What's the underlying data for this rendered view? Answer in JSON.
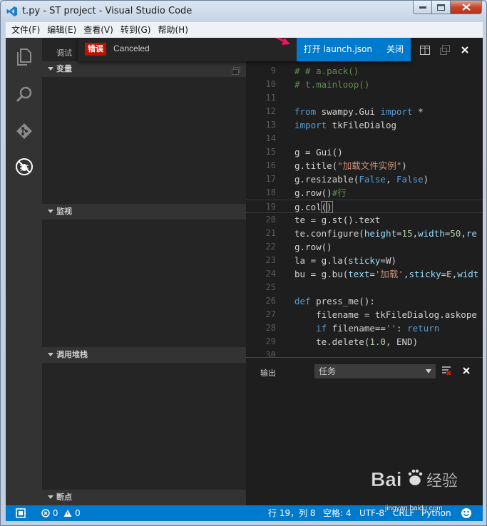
{
  "window": {
    "title": "t.py - ST project - Visual Studio Code"
  },
  "menu": [
    "文件(F)",
    "编辑(E)",
    "查看(V)",
    "转到(G)",
    "帮助(H)"
  ],
  "sidebar": {
    "title": "调试",
    "sections": [
      {
        "label": "变量"
      },
      {
        "label": "监视"
      },
      {
        "label": "调用堆栈"
      },
      {
        "label": "断点"
      }
    ]
  },
  "notification": {
    "badge": "错误",
    "message": "Canceled",
    "action_primary": "打开 launch.json",
    "action_close": "关闭"
  },
  "editor": {
    "lines": [
      {
        "n": "9",
        "text": "# # a.pack()"
      },
      {
        "n": "10",
        "text": "# t.mainloop()"
      },
      {
        "n": "11",
        "text": ""
      },
      {
        "n": "12",
        "text": "from swampy.Gui import *"
      },
      {
        "n": "13",
        "text": "import tkFileDialog"
      },
      {
        "n": "14",
        "text": ""
      },
      {
        "n": "15",
        "text": "g = Gui()"
      },
      {
        "n": "16",
        "text": "g.title(\"加载文件实例\")"
      },
      {
        "n": "17",
        "text": "g.resizable(False, False)"
      },
      {
        "n": "18",
        "text": "g.row()#行"
      },
      {
        "n": "19",
        "text": "g.col()"
      },
      {
        "n": "20",
        "text": "te = g.st().text"
      },
      {
        "n": "21",
        "text": "te.configure(height=15,width=50,re"
      },
      {
        "n": "22",
        "text": "g.row()"
      },
      {
        "n": "23",
        "text": "la = g.la(sticky=W)"
      },
      {
        "n": "24",
        "text": "bu = g.bu(text='加载',sticky=E,widt"
      },
      {
        "n": "25",
        "text": ""
      },
      {
        "n": "26",
        "text": "def press_me():"
      },
      {
        "n": "27",
        "text": "    filename = tkFileDialog.askope"
      },
      {
        "n": "28",
        "text": "    if filename=='': return"
      },
      {
        "n": "29",
        "text": "    te.delete(1.0, END)"
      },
      {
        "n": "30",
        "text": ""
      }
    ]
  },
  "panel": {
    "title": "输出",
    "select_value": "任务"
  },
  "status": {
    "errors": "0",
    "warnings": "0",
    "position": "行 19，列 8",
    "spaces": "空格: 4",
    "encoding": "UTF-8",
    "eol": "CRLF",
    "language": "Python"
  },
  "watermark": {
    "text": "jingyan.baidu.com"
  },
  "colors": {
    "accent": "#007acc",
    "error_badge": "#be1100",
    "annotation_arrow": "#e8175d"
  }
}
